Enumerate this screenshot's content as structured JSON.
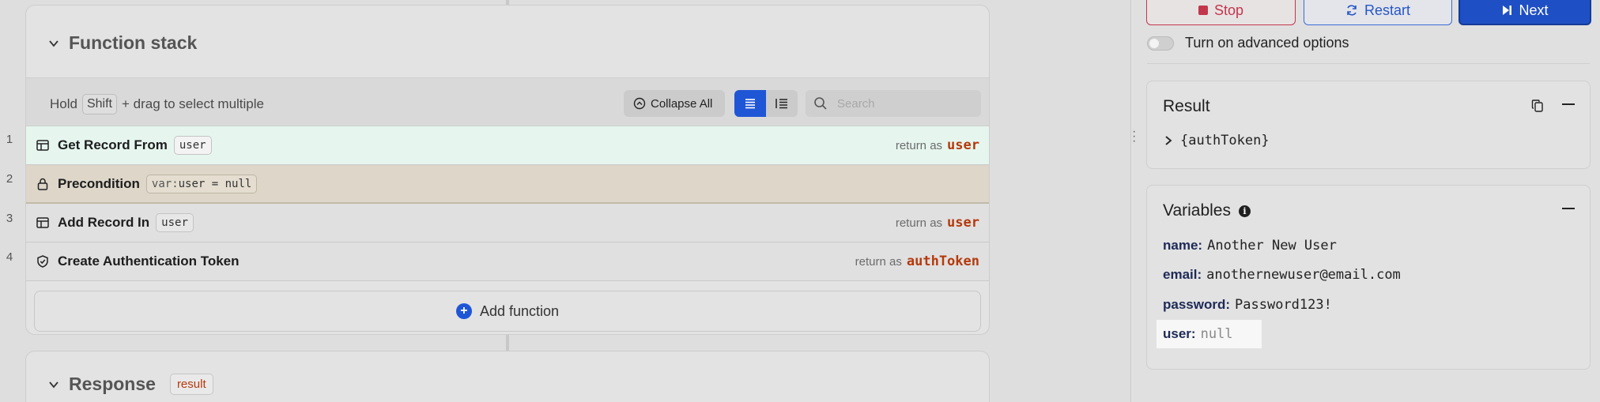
{
  "function_stack": {
    "title": "Function stack",
    "hold": "Hold",
    "shift_key": "Shift",
    "drag_hint": "+ drag to select multiple",
    "collapse_all": "Collapse All",
    "search_placeholder": "Search",
    "rows": [
      {
        "num": "1",
        "name": "Get Record From",
        "tag": "user",
        "return_label": "return as",
        "return_value": "user",
        "icon": "table-icon"
      },
      {
        "num": "2",
        "name": "Precondition",
        "tag_key": "var:",
        "tag": "user = null",
        "icon": "lock-icon"
      },
      {
        "num": "3",
        "name": "Add Record In",
        "tag": "user",
        "return_label": "return as",
        "return_value": "user",
        "icon": "table-icon"
      },
      {
        "num": "4",
        "name": "Create Authentication Token",
        "return_label": "return as",
        "return_value": "authToken",
        "icon": "shield-check-icon"
      }
    ],
    "add_function": "Add function"
  },
  "response": {
    "title": "Response",
    "tag": "result"
  },
  "controls": {
    "stop": "Stop",
    "restart": "Restart",
    "next": "Next",
    "advanced_toggle": "Turn on advanced options",
    "advanced_on": false
  },
  "result": {
    "title": "Result",
    "value": "{authToken}"
  },
  "variables": {
    "title": "Variables",
    "items": [
      {
        "key": "name",
        "value": "Another New User"
      },
      {
        "key": "email",
        "value": "anothernewuser@email.com"
      },
      {
        "key": "password",
        "value": "Password123!"
      },
      {
        "key": "user",
        "value": "null"
      }
    ]
  },
  "colors": {
    "accent": "#1f56d6",
    "return_value": "#b53a0c",
    "stop": "#c2364c"
  }
}
